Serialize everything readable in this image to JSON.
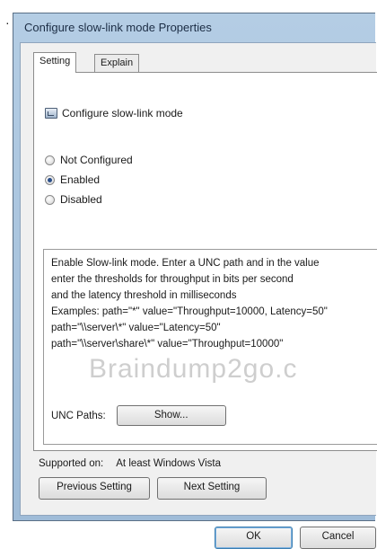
{
  "window": {
    "title": "Configure slow-link mode Properties"
  },
  "tabs": [
    {
      "label": "Setting"
    },
    {
      "label": "Explain"
    }
  ],
  "policy": {
    "name": "Configure slow-link mode"
  },
  "radio_options": [
    {
      "label": "Not Configured",
      "checked": false
    },
    {
      "label": "Enabled",
      "checked": true
    },
    {
      "label": "Disabled",
      "checked": false
    }
  ],
  "options": {
    "help_lines": [
      "Enable Slow-link mode. Enter a UNC path and in the value",
      "enter the thresholds for throughput in bits per second",
      "and the latency threshold in milliseconds",
      "Examples: path=\"*\" value=\"Throughput=10000, Latency=50\"",
      "path=\"\\\\server\\*\" value=\"Latency=50\"",
      "path=\"\\\\server\\share\\*\" value=\"Throughput=10000\""
    ],
    "unc_label": "UNC Paths:",
    "show_button": "Show..."
  },
  "watermark": "Braindump2go.c",
  "supported": {
    "label": "Supported on:",
    "value": "At least Windows Vista"
  },
  "nav": {
    "previous": "Previous Setting",
    "next": "Next Setting"
  },
  "footer": {
    "ok": "OK",
    "cancel": "Cancel"
  }
}
